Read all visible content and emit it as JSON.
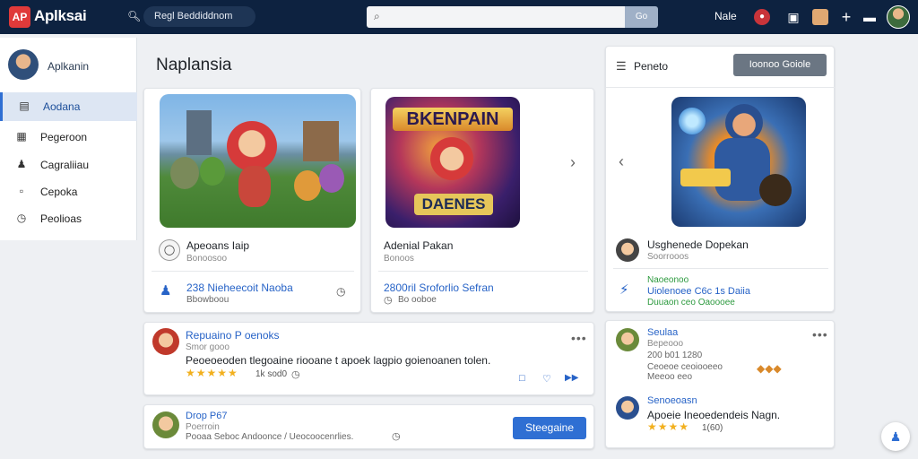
{
  "app": {
    "logo_mark": "AP",
    "logo_text": "Aplksai",
    "nav_pill": "Regl Beddiddnom",
    "search": {
      "placeholder": "",
      "button": "Go"
    },
    "user_name": "Nale",
    "icons": [
      "notification-icon",
      "clipboard-icon",
      "messages-icon",
      "add-icon",
      "toggle-icon"
    ]
  },
  "sidebar": {
    "user": "Aplkanin",
    "items": [
      {
        "label": "Aodana",
        "icon": "document-icon",
        "active": true
      },
      {
        "label": "Pegeroon",
        "icon": "grid-icon",
        "active": false
      },
      {
        "label": "Cagraliiau",
        "icon": "users-icon",
        "active": false
      },
      {
        "label": "Cepoka",
        "icon": "box-icon",
        "active": false
      },
      {
        "label": "Peolioas",
        "icon": "clock-icon",
        "active": false
      }
    ]
  },
  "main": {
    "title": "Naplansia",
    "featured": [
      {
        "title": "Apeoans Iaip",
        "sub": "Bonoosoo",
        "link": "238 Nieheecoit Naoba",
        "meta": "Bbowboou"
      },
      {
        "title": "Adenial Pakan",
        "sub": "Bonoos",
        "banner_top": "BKENPAIN",
        "banner_bottom": "DAENES",
        "link": "2800ril Sroforlio Sefran",
        "meta": "Bo ooboe"
      }
    ],
    "feed": [
      {
        "title": "Repuaino P oenoks",
        "sub": "Smor gooo",
        "body": "Peoeoeoden tlegoaine riooane t apoek lagpio goienoanen tolen.",
        "rating": "1k sod0",
        "menu": "•••"
      },
      {
        "title": "Drop P67",
        "sub": "Poerroin",
        "body": "Pooaa Seboc Andoonce / Ueocoocenrlies.",
        "button": "Steegaine"
      }
    ]
  },
  "right_panel": {
    "header_label": "Peneto",
    "header_button": "Ioonoo Goiole",
    "feature": {
      "title": "Usghenede Dopekan",
      "sub": "Soorrooos",
      "lines": [
        "Naoeonoo",
        "Uiolenoee C6c 1s Daiia",
        "Duuaon ceo Oaoooee"
      ]
    },
    "reviews": [
      {
        "name": "Seulaa",
        "sub": "Bepeooo",
        "line": "200 b01 1280",
        "desc": "Ceoeoe ceoiooeeo",
        "desc2": "Meeoo eeo",
        "menu": "•••"
      },
      {
        "name": "Senoeoasn",
        "body": "Apoeie Ineoedendeis Nagn.",
        "rating": "1(60)"
      }
    ]
  },
  "colors": {
    "topbar": "#0d2240",
    "accent": "#2f6fd3",
    "star": "#f2b01e",
    "link": "#2763c7"
  }
}
